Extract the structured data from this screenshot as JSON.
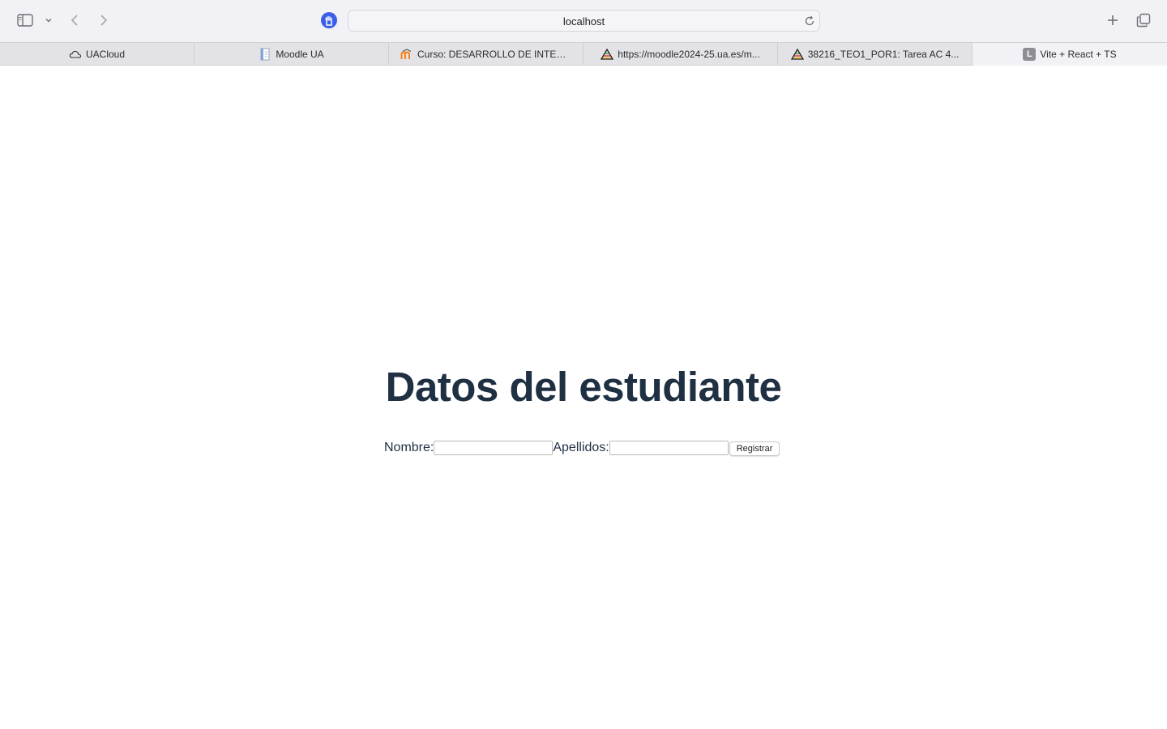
{
  "browser": {
    "address": "localhost",
    "tabs": [
      {
        "label": "UACloud",
        "icon": "cloud-icon",
        "active": false
      },
      {
        "label": "Moodle UA",
        "icon": "document-icon",
        "active": false
      },
      {
        "label": "Curso: DESARROLLO DE INTER...",
        "icon": "moodle-icon",
        "active": false
      },
      {
        "label": "https://moodle2024-25.ua.es/m...",
        "icon": "ua-logo-icon",
        "active": false
      },
      {
        "label": "38216_TEO1_POR1: Tarea AC 4...",
        "icon": "ua-logo-icon",
        "active": false
      },
      {
        "label": "Vite + React + TS",
        "icon": "letter-l-icon",
        "favicon_letter": "L",
        "active": true
      }
    ]
  },
  "page": {
    "heading": "Datos del estudiante",
    "form": {
      "nombre_label": "Nombre:",
      "nombre_value": "",
      "apellidos_label": "Apellidos:",
      "apellidos_value": "",
      "submit_label": "Registrar"
    }
  },
  "colors": {
    "heading": "#1f3043",
    "shield": "#3b5ee8",
    "toolbar_bg": "#f2f1f6"
  }
}
